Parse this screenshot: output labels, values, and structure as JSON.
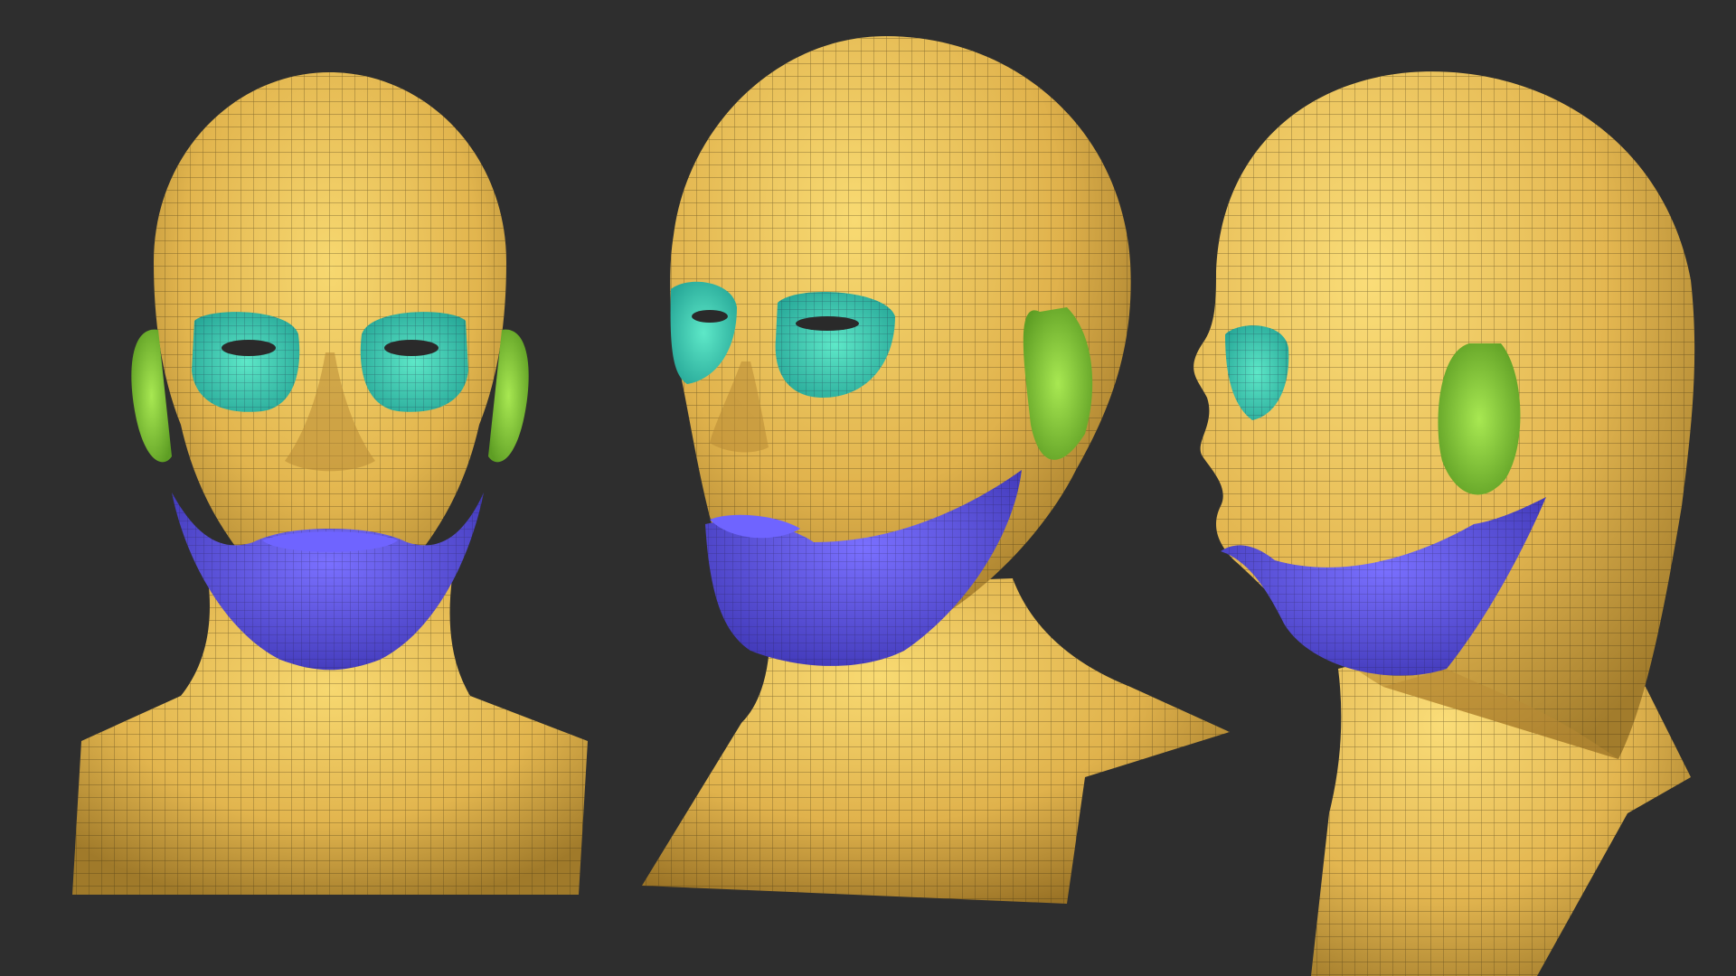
{
  "scene": {
    "background": "#2e2e2e",
    "views": [
      {
        "name": "front-view"
      },
      {
        "name": "three-quarter-view"
      },
      {
        "name": "side-view"
      }
    ]
  },
  "colors": {
    "skin": "#e2b54e",
    "skin_light": "#f5d36a",
    "skin_shadow": "#9c7626",
    "eye_region": "#3fd6b4",
    "eye_region_dark": "#2aa596",
    "mouth_chin_region": "#5a4fe6",
    "mouth_chin_dark": "#3d35b3",
    "ear_region": "#8ed63c",
    "ear_region_dark": "#5e9e24",
    "wireframe": "#3a2e10"
  }
}
